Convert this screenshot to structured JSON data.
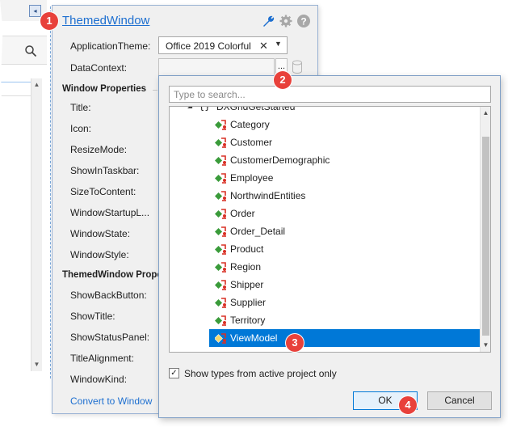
{
  "panel": {
    "title": "ThemedWindow",
    "properties_top": [
      {
        "label": "ApplicationTheme:"
      },
      {
        "label": "DataContext:"
      }
    ],
    "theme_value": "Office 2019 Colorful",
    "section_window": "Window Properties",
    "window_props": [
      "Title:",
      "Icon:",
      "ResizeMode:",
      "ShowInTaskbar:",
      "SizeToContent:",
      "WindowStartupL...",
      "WindowState:",
      "WindowStyle:"
    ],
    "section_themed": "ThemedWindow Properties",
    "themed_props": [
      "ShowBackButton:",
      "ShowTitle:",
      "ShowStatusPanel:",
      "TitleAlignment:",
      "WindowKind:"
    ],
    "convert_link": "Convert to Window",
    "icons": [
      "wrench-icon",
      "gear-icon",
      "help-icon"
    ]
  },
  "popup": {
    "search_placeholder": "Type to search...",
    "namespace": "DXGridGetStarted",
    "namespace_glyph": "{}",
    "types": [
      "Category",
      "Customer",
      "CustomerDemographic",
      "Employee",
      "NorthwindEntities",
      "Order",
      "Order_Detail",
      "Product",
      "Region",
      "Shipper",
      "Supplier",
      "Territory",
      "ViewModel"
    ],
    "selected_type": "ViewModel",
    "checkbox_label": "Show types from active project only",
    "checkbox_checked": true,
    "ok_label": "OK",
    "cancel_label": "Cancel"
  },
  "badges": [
    "1",
    "2",
    "3",
    "4"
  ],
  "colors": {
    "accent": "#1d6fd0",
    "selection": "#0078d7",
    "badge": "#e8413b"
  }
}
